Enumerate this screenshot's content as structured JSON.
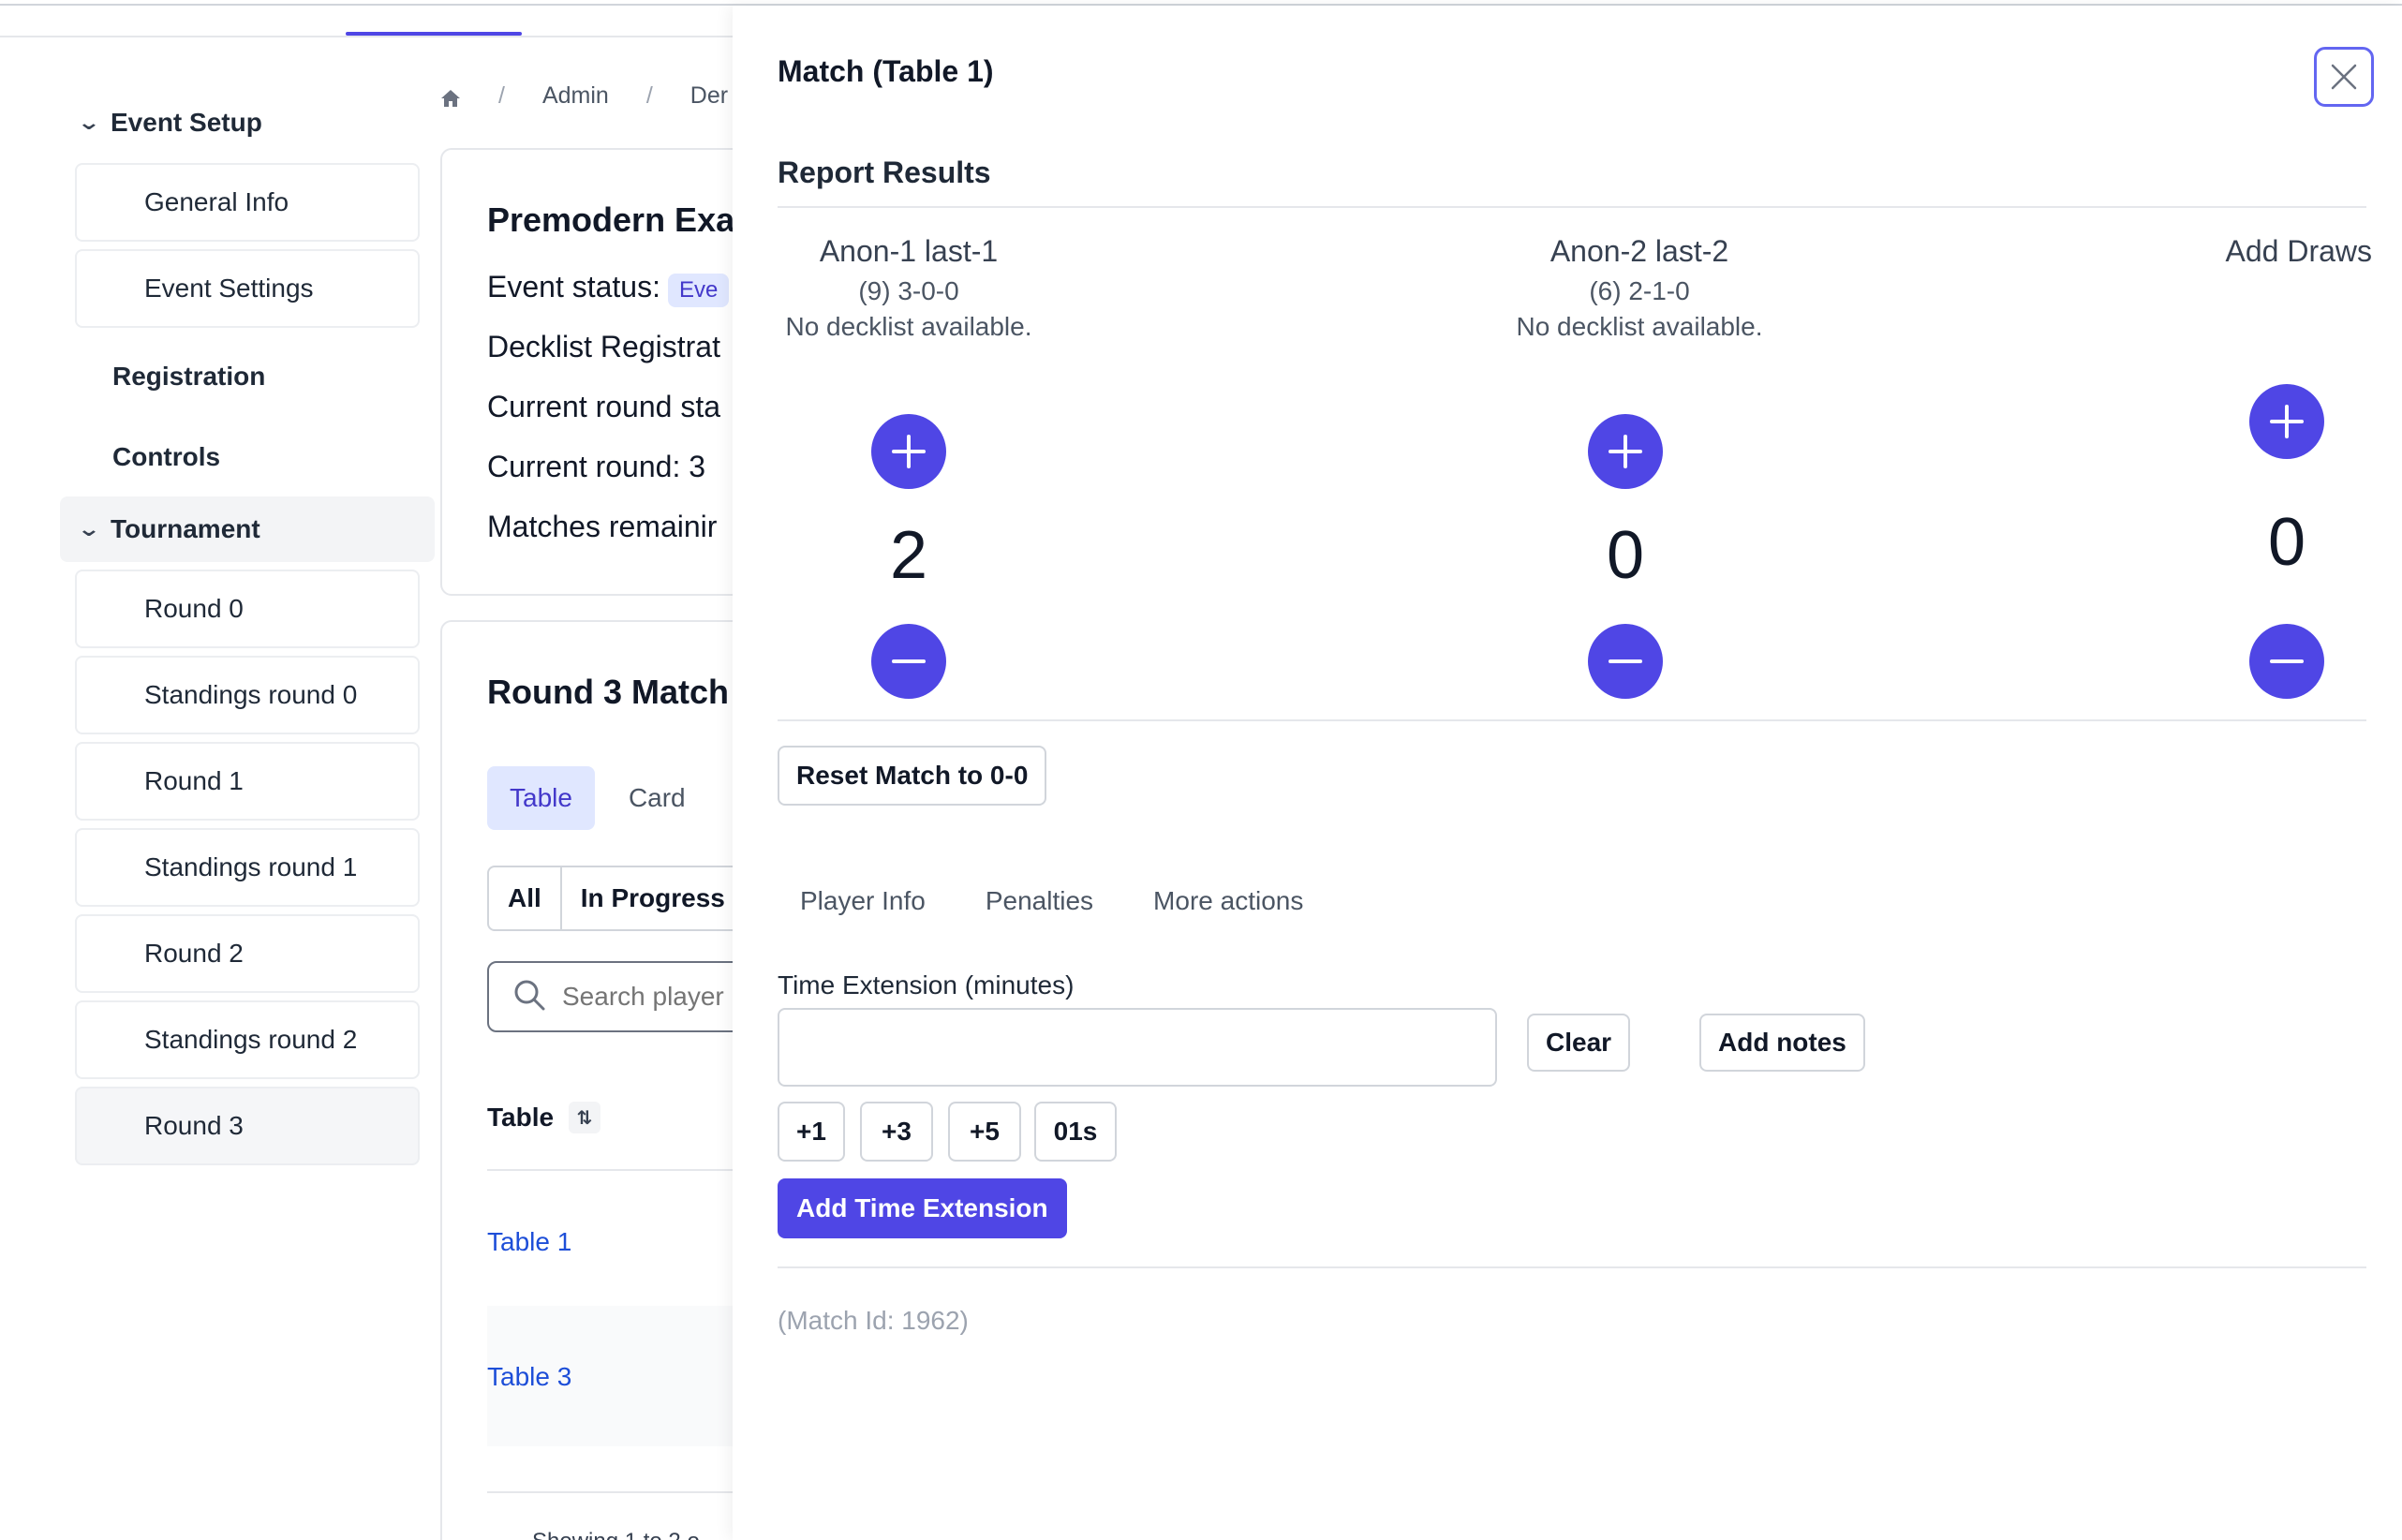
{
  "sidebar": {
    "event_setup": "Event Setup",
    "general_info": "General Info",
    "event_settings": "Event Settings",
    "registration": "Registration",
    "controls": "Controls",
    "tournament": "Tournament",
    "rounds": [
      "Round 0",
      "Standings round 0",
      "Round 1",
      "Standings round 1",
      "Round 2",
      "Standings round 2",
      "Round 3"
    ]
  },
  "breadcrumb": {
    "admin": "Admin",
    "current": "Der"
  },
  "event_card": {
    "title": "Premodern Exa",
    "status_label": "Event status:",
    "status_value": "Eve",
    "decklist_line": "Decklist Registrat",
    "round_status_line": "Current round sta",
    "current_round_line": "Current round: 3",
    "matches_line": "Matches remainir"
  },
  "matches_card": {
    "title": "Round 3 Match",
    "tabs": [
      "Table",
      "Card"
    ],
    "filters": [
      "All",
      "In Progress"
    ],
    "search_placeholder": "Search player",
    "column_table": "Table",
    "rows": [
      "Table 1",
      "Table 3"
    ],
    "footer": "Showing 1 to 2 o"
  },
  "drawer": {
    "title": "Match (Table 1)",
    "section_title": "Report Results",
    "player1": {
      "name": "Anon-1 last-1",
      "record": "(9) 3-0-0",
      "decklist": "No decklist available.",
      "score": "2"
    },
    "player2": {
      "name": "Anon-2 last-2",
      "record": "(6) 2-1-0",
      "decklist": "No decklist available.",
      "score": "0"
    },
    "draws": {
      "label": "Add Draws",
      "score": "0"
    },
    "reset_label": "Reset Match to 0-0",
    "subtabs": [
      "Player Info",
      "Penalties",
      "More actions"
    ],
    "time_ext_label": "Time Extension (minutes)",
    "time_ext_value": "",
    "clear_label": "Clear",
    "add_notes_label": "Add notes",
    "quick_buttons": [
      "+1",
      "+3",
      "+5",
      "01s"
    ],
    "add_time_label": "Add Time Extension",
    "match_id": "(Match Id: 1962)"
  },
  "colors": {
    "accent": "#4f46e5",
    "link": "#1d4ed8",
    "badge_bg": "#e0e7ff"
  }
}
